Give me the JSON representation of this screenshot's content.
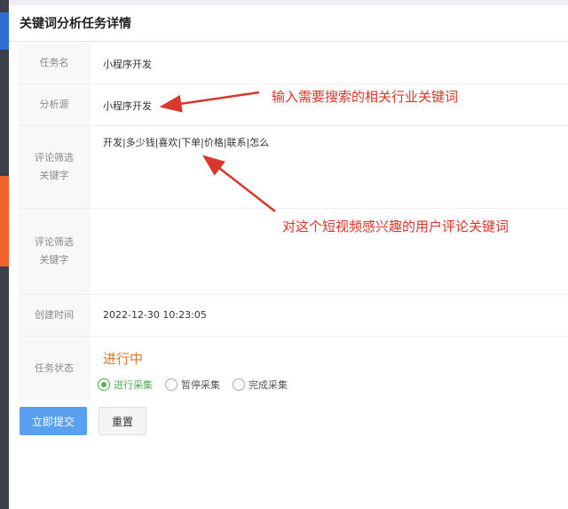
{
  "panel": {
    "title": "关键词分析任务详情"
  },
  "form": {
    "task_name": {
      "label": "任务名",
      "value": "小程序开发"
    },
    "source": {
      "label": "分析源",
      "value": "小程序开发"
    },
    "filter1": {
      "label_line1": "评论筛选",
      "label_line2": "关键字",
      "value": "开发|多少钱|喜欢|下单|价格|联系|怎么"
    },
    "filter2": {
      "label_line1": "评论筛选",
      "label_line2": "关键字",
      "value": ""
    },
    "created": {
      "label": "创建时间",
      "value": "2022-12-30 10:23:05"
    },
    "status": {
      "label": "任务状态",
      "text": "进行中",
      "options": [
        "进行采集",
        "暂停采集",
        "完成采集"
      ],
      "selected": "进行采集"
    }
  },
  "buttons": {
    "submit": "立即提交",
    "reset": "重置"
  },
  "annotations": {
    "note1": "输入需要搜索的相关行业关键词",
    "note2": "对这个短视频感兴趣的用户评论关键词"
  },
  "colors": {
    "accent": "#5aa0f0",
    "status": "#e0782c",
    "annotation": "#d8372b",
    "radio_active": "#4caf50"
  }
}
